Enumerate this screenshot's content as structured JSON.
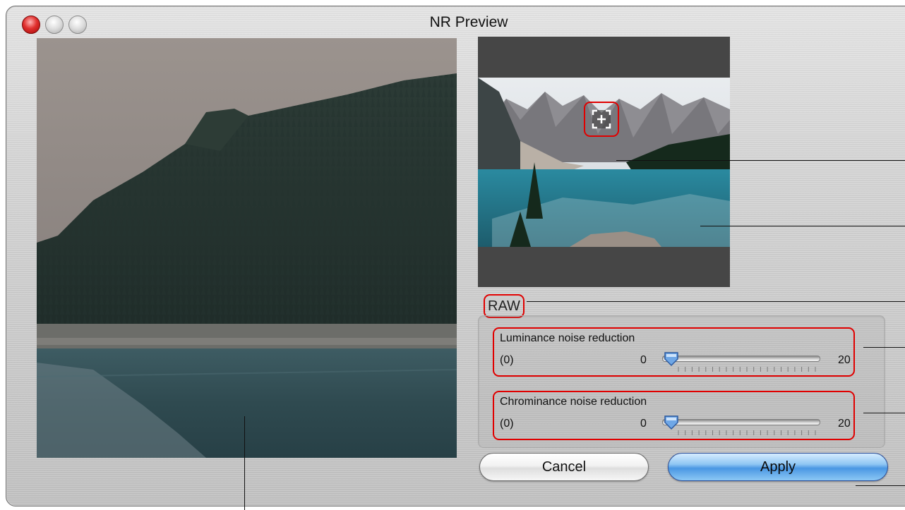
{
  "window": {
    "title": "NR Preview"
  },
  "traffic_lights": [
    "close-icon",
    "minimize-icon",
    "zoom-icon"
  ],
  "raw_label": "RAW",
  "luminance": {
    "title": "Luminance noise reduction",
    "current": "(0)",
    "min": "0",
    "max": "20",
    "value_fraction": 0
  },
  "chrominance": {
    "title": "Chrominance noise reduction",
    "current": "(0)",
    "min": "0",
    "max": "20",
    "value_fraction": 0
  },
  "buttons": {
    "cancel": "Cancel",
    "apply": "Apply"
  },
  "colors": {
    "highlight": "#e00000",
    "apply_blue": "#4a97e3"
  }
}
